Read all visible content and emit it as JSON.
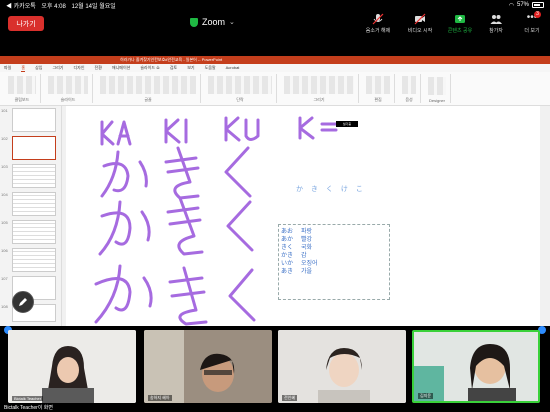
{
  "status": {
    "carrier": "◀ 카카오톡",
    "time": "오후 4:08",
    "date": "12월 14일 월요일",
    "battery": "57%"
  },
  "zoom": {
    "leave_label": "나가기",
    "title": "Zoom",
    "tools": [
      {
        "icon": "mute-icon",
        "label": "음소거 해제"
      },
      {
        "icon": "video-icon",
        "label": "비디오 시작"
      },
      {
        "icon": "share-icon",
        "label": "콘텐츠 공유"
      },
      {
        "icon": "participants-icon",
        "label": "참가자"
      },
      {
        "icon": "more-icon",
        "label": "더 보기",
        "badge": "3"
      }
    ],
    "colors": {
      "leave": "#d9302c",
      "secure": "#1fb843",
      "share": "#1fb843"
    }
  },
  "ppt": {
    "title_text": "히라가나 즐겨찾기인칸보호#안전교육 - 일본어 -- PowerPoint",
    "menu": [
      "파일",
      "홈",
      "삽입",
      "그리기",
      "디자인",
      "전환",
      "애니메이션",
      "슬라이드 쇼",
      "검토",
      "보기",
      "도움말",
      "Acrobat"
    ],
    "active_menu": "홈",
    "ribbon_groups": [
      "클립보드",
      "슬라이드",
      "글꼴",
      "단락",
      "그리기",
      "편집",
      "음성",
      "Designer"
    ],
    "slide_numbers": [
      "101",
      "102",
      "103",
      "104",
      "105",
      "106",
      "107",
      "108",
      "109",
      "110"
    ],
    "selected_slide": "102"
  },
  "slide": {
    "hand_label": "KA KI KU K",
    "tag": "필기중",
    "kana_row": "か き く け こ",
    "table": [
      [
        "あお",
        "파랑"
      ],
      [
        "あか",
        "빨강"
      ],
      [
        "きく",
        "국화"
      ],
      [
        "かき",
        "감"
      ],
      [
        "いか",
        "오징어"
      ],
      [
        "あき",
        "가을"
      ]
    ]
  },
  "participants": [
    {
      "name": "Bictalk Teacher"
    },
    {
      "name": "송하지 혜아"
    },
    {
      "name": "전인혜"
    },
    {
      "name": "김지윤"
    }
  ],
  "caption": "Bictalk Teacher이 화면"
}
